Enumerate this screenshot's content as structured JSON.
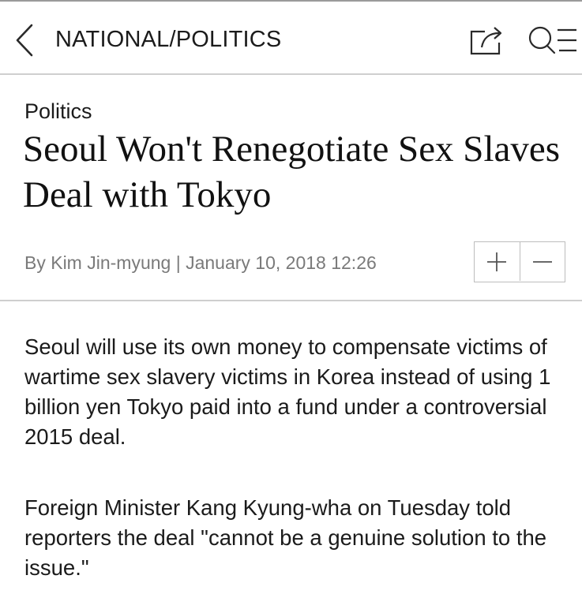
{
  "header": {
    "section_title": "NATIONAL/POLITICS",
    "icons": [
      "back-chevron-icon",
      "share-icon",
      "search-menu-icon"
    ]
  },
  "article": {
    "category": "Politics",
    "headline": "Seoul Won't Renegotiate Sex Slaves Deal with Tokyo",
    "byline": "By Kim Jin-myung | January 10, 2018 12:26",
    "paragraphs": [
      "Seoul will use its own money to compensate victims of wartime sex slavery victims in Korea instead of using 1 billion yen Tokyo paid into a fund under a controversial 2015 deal.",
      "Foreign Minister Kang Kyung-wha on Tuesday told reporters the deal \"cannot be a genuine solution to the issue.\""
    ]
  },
  "font_controls": {
    "increase_icon": "plus-icon",
    "decrease_icon": "minus-icon"
  },
  "colors": {
    "text": "#1b1b1b",
    "byline": "#7a7a7a",
    "divider": "#cfcfcf"
  }
}
